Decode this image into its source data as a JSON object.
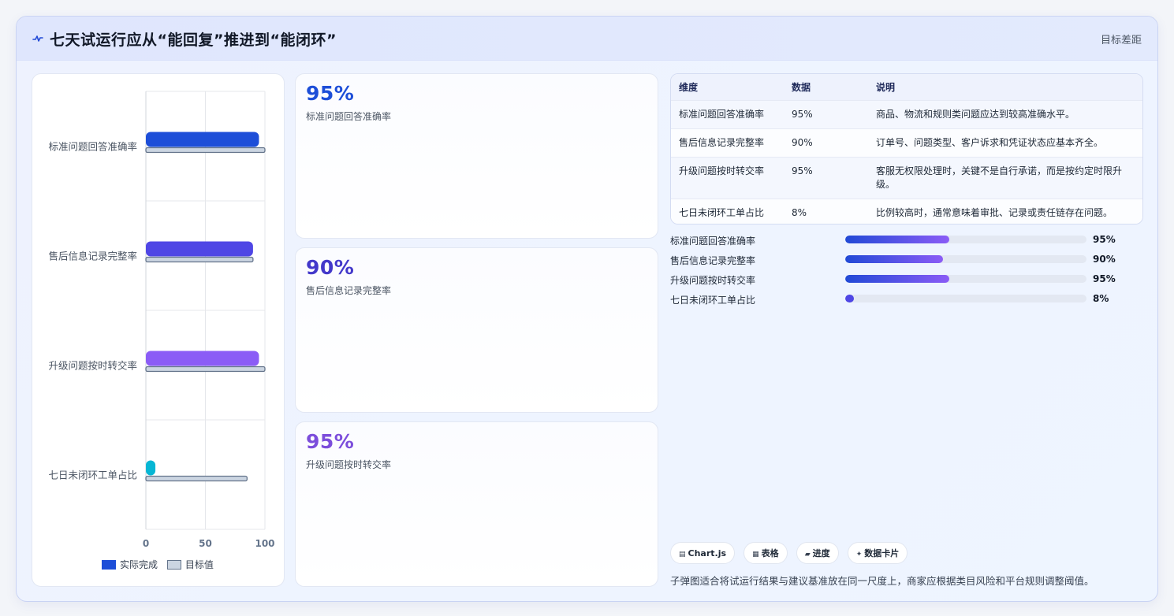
{
  "header": {
    "icon": "pulse-icon",
    "title": "七天试运行应从“能回复”推进到“能闭环”",
    "right_label": "目标差距"
  },
  "colors": {
    "blue": "#1d4ed8",
    "indigo": "#4f46e5",
    "violet": "#8b5cf6",
    "cyan": "#06b6d4",
    "target": "#cbd5e1"
  },
  "chart_data": {
    "type": "bar",
    "orientation": "horizontal",
    "categories": [
      "标准问题回答准确率",
      "售后信息记录完整率",
      "升级问题按时转交率",
      "七日未闭环工单占比"
    ],
    "series": [
      {
        "name": "实际完成",
        "values": [
          95,
          90,
          95,
          8
        ]
      },
      {
        "name": "目标值",
        "values": [
          100,
          90,
          100,
          85
        ]
      }
    ],
    "xlim": [
      0,
      100
    ],
    "xticks": [
      "0",
      "50",
      "100"
    ],
    "grid": true,
    "legend": "bottom"
  },
  "cards": [
    {
      "value": "95%",
      "label": "标准问题回答准确率",
      "color": "#1d4ed8"
    },
    {
      "value": "90%",
      "label": "售后信息记录完整率",
      "color": "#4338ca"
    },
    {
      "value": "95%",
      "label": "升级问题按时转交率",
      "color": "#7c4ddb"
    }
  ],
  "table": {
    "headers": [
      "维度",
      "数据",
      "说明"
    ],
    "rows": [
      [
        "标准问题回答准确率",
        "95%",
        "商品、物流和规则类问题应达到较高准确水平。"
      ],
      [
        "售后信息记录完整率",
        "90%",
        "订单号、问题类型、客户诉求和凭证状态应基本齐全。"
      ],
      [
        "升级问题按时转交率",
        "95%",
        "客服无权限处理时，关键不是自行承诺，而是按约定时限升级。"
      ],
      [
        "七日未闭环工单占比",
        "8%",
        "比例较高时，通常意味着审批、记录或责任链存在问题。"
      ]
    ]
  },
  "progress": [
    {
      "label": "标准问题回答准确率",
      "value": "95%",
      "fraction": 0.43
    },
    {
      "label": "售后信息记录完整率",
      "value": "90%",
      "fraction": 0.405
    },
    {
      "label": "升级问题按时转交率",
      "value": "95%",
      "fraction": 0.43
    },
    {
      "label": "七日未闭环工单占比",
      "value": "8%",
      "fraction": 0.036
    }
  ],
  "tags": [
    {
      "icon": "chart-icon",
      "glyph": "▤",
      "label": "Chart.js"
    },
    {
      "icon": "table-icon",
      "glyph": "▦",
      "label": "表格"
    },
    {
      "icon": "progress-icon",
      "glyph": "▰",
      "label": "进度"
    },
    {
      "icon": "sparkle-icon",
      "glyph": "✦",
      "label": "数据卡片"
    }
  ],
  "footnote": "子弹图适合将试运行结果与建议基准放在同一尺度上，商家应根据类目风险和平台规则调整阈值。"
}
